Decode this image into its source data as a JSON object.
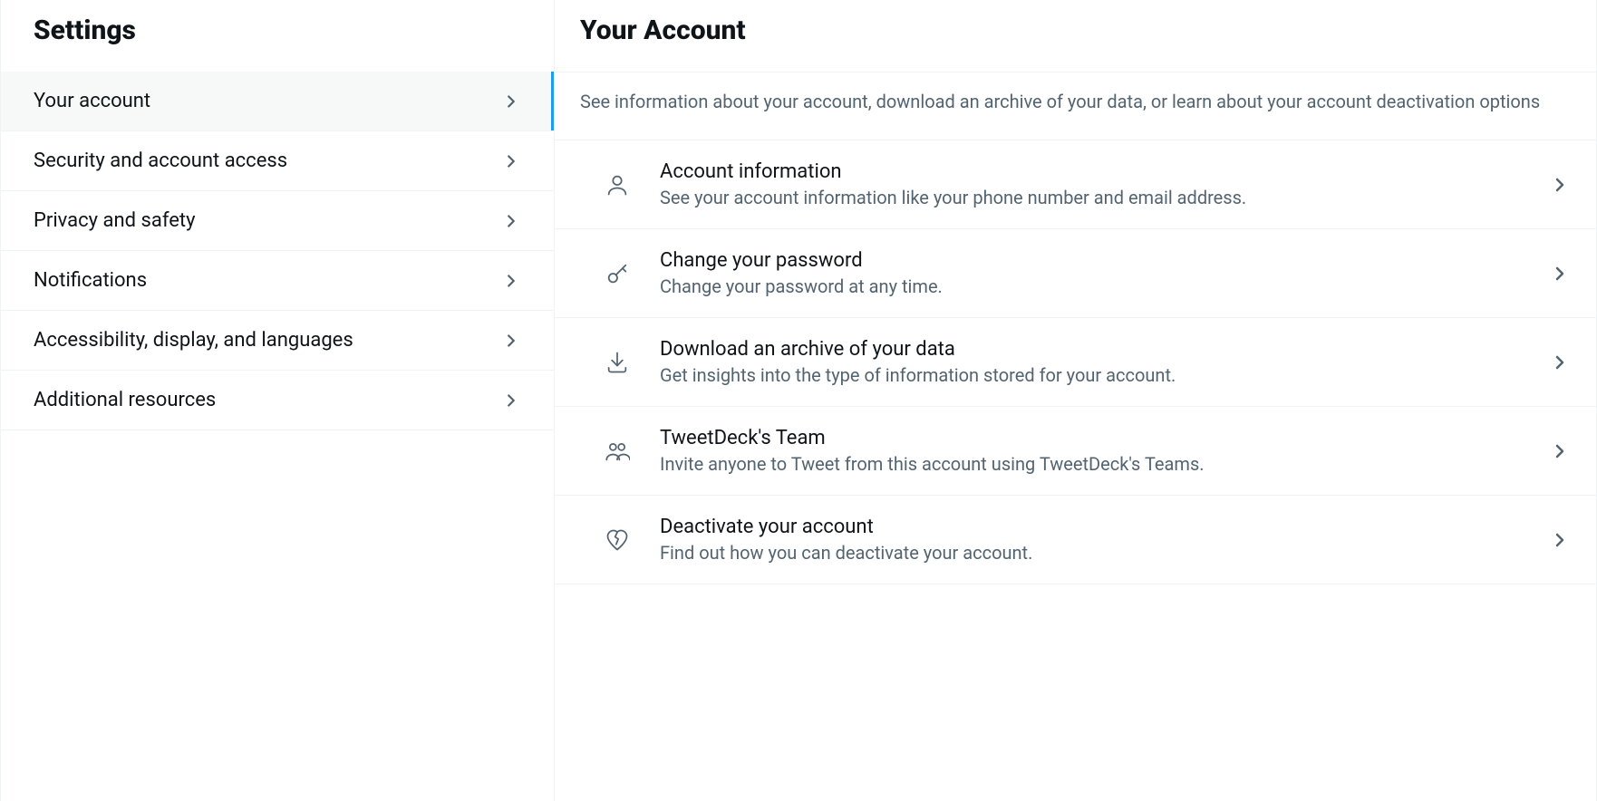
{
  "sidebar": {
    "title": "Settings",
    "items": [
      {
        "label": "Your account",
        "active": true
      },
      {
        "label": "Security and account access",
        "active": false
      },
      {
        "label": "Privacy and safety",
        "active": false
      },
      {
        "label": "Notifications",
        "active": false
      },
      {
        "label": "Accessibility, display, and languages",
        "active": false
      },
      {
        "label": "Additional resources",
        "active": false
      }
    ]
  },
  "main": {
    "title": "Your Account",
    "description": "See information about your account, download an archive of your data, or learn about your account deactivation options",
    "options": [
      {
        "title": "Account information",
        "subtitle": "See your account information like your phone number and email address."
      },
      {
        "title": "Change your password",
        "subtitle": "Change your password at any time."
      },
      {
        "title": "Download an archive of your data",
        "subtitle": "Get insights into the type of information stored for your account."
      },
      {
        "title": "TweetDeck's Team",
        "subtitle": "Invite anyone to Tweet from this account using TweetDeck's Teams."
      },
      {
        "title": "Deactivate your account",
        "subtitle": "Find out how you can deactivate your account."
      }
    ]
  }
}
